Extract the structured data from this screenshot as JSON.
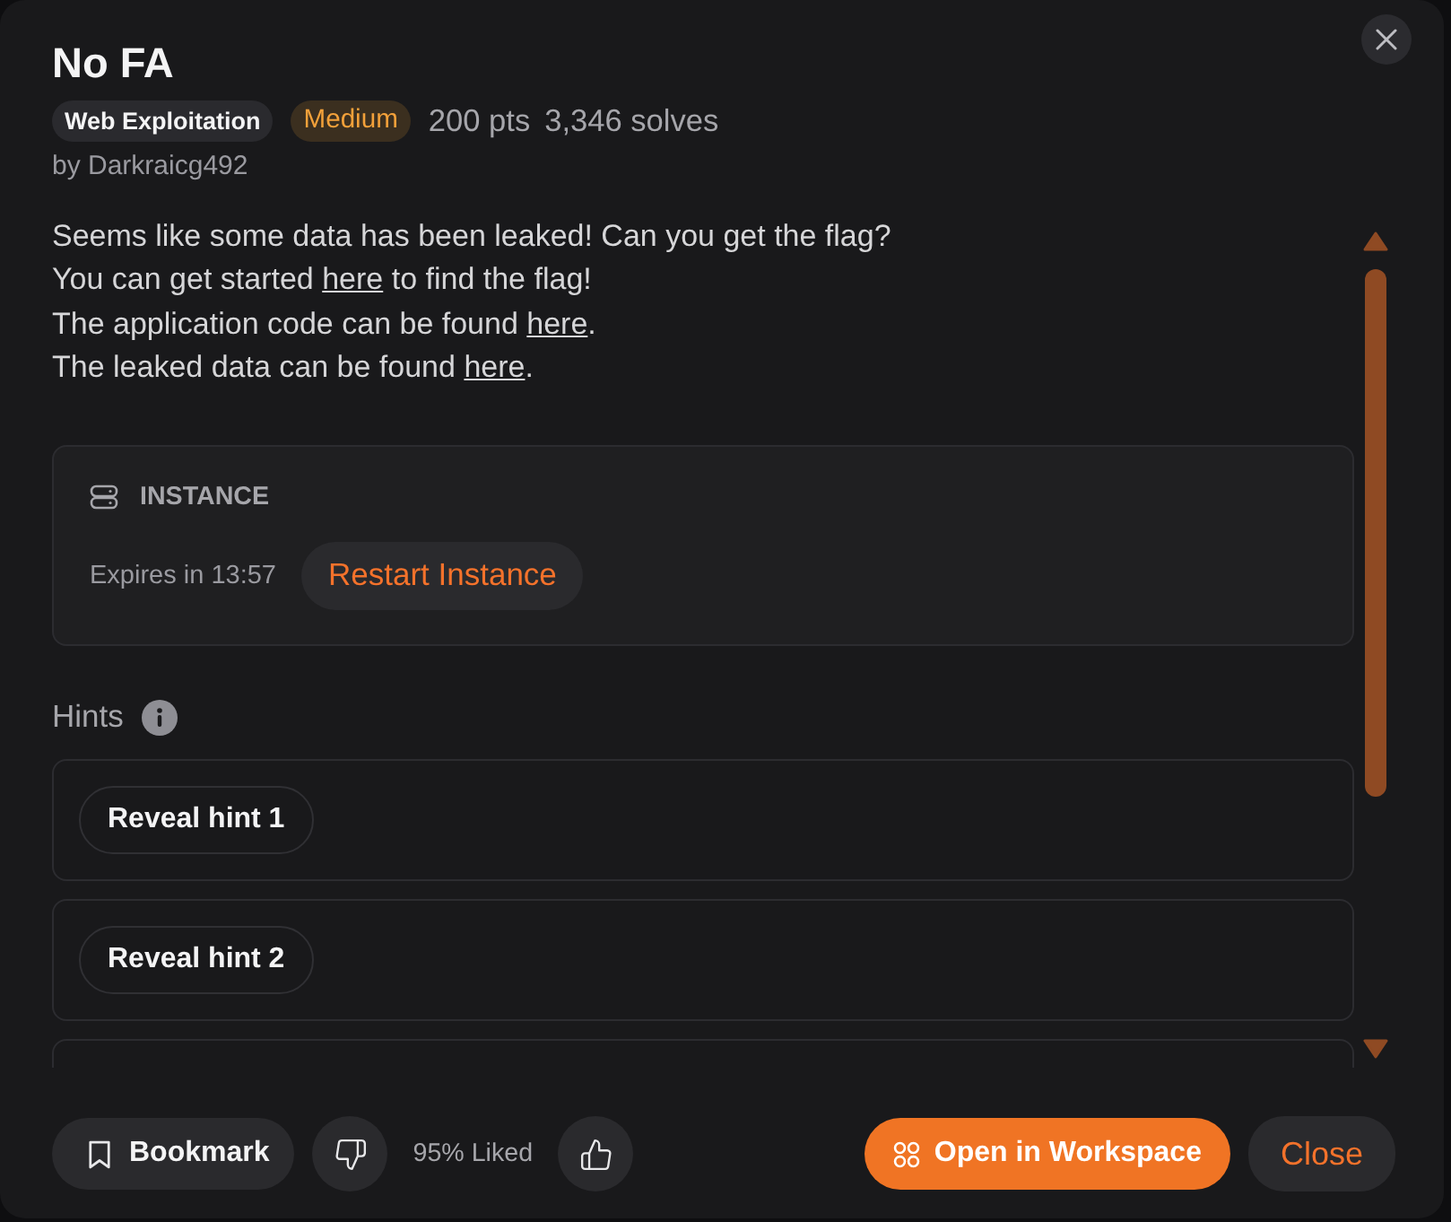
{
  "dialog": {
    "title": "No FA",
    "category": "Web Exploitation",
    "difficulty": {
      "label": "Medium",
      "kind": "medium"
    },
    "points": "200 pts",
    "solves": "3,346 solves",
    "author": "by Darkraicg492"
  },
  "description": [
    [
      {
        "kind": "text",
        "text": "Seems like some data has been leaked! Can you get the flag?"
      }
    ],
    [
      {
        "kind": "text",
        "text": "You can get started "
      },
      {
        "kind": "link",
        "text": "here"
      },
      {
        "kind": "text",
        "text": " to find the flag!"
      }
    ],
    [
      {
        "kind": "text",
        "text": "The application code can be found "
      },
      {
        "kind": "link",
        "text": "here"
      },
      {
        "kind": "text",
        "text": "."
      }
    ],
    [
      {
        "kind": "text",
        "text": "The leaked data can be found "
      },
      {
        "kind": "link",
        "text": "here"
      },
      {
        "kind": "text",
        "text": "."
      }
    ]
  ],
  "instance": {
    "heading": "INSTANCE",
    "expires": "Expires in 13:57",
    "restart_button": "Restart Instance"
  },
  "hints": {
    "heading": "Hints",
    "items": [
      {
        "kind": "button",
        "button": "Reveal hint 1"
      },
      {
        "kind": "button",
        "button": "Reveal hint 2"
      },
      {
        "kind": "empty"
      }
    ]
  },
  "footer": {
    "bookmark_button": "Bookmark",
    "rating": "95% Liked",
    "primary_button": "Open in Workspace",
    "close_button": "Close"
  }
}
